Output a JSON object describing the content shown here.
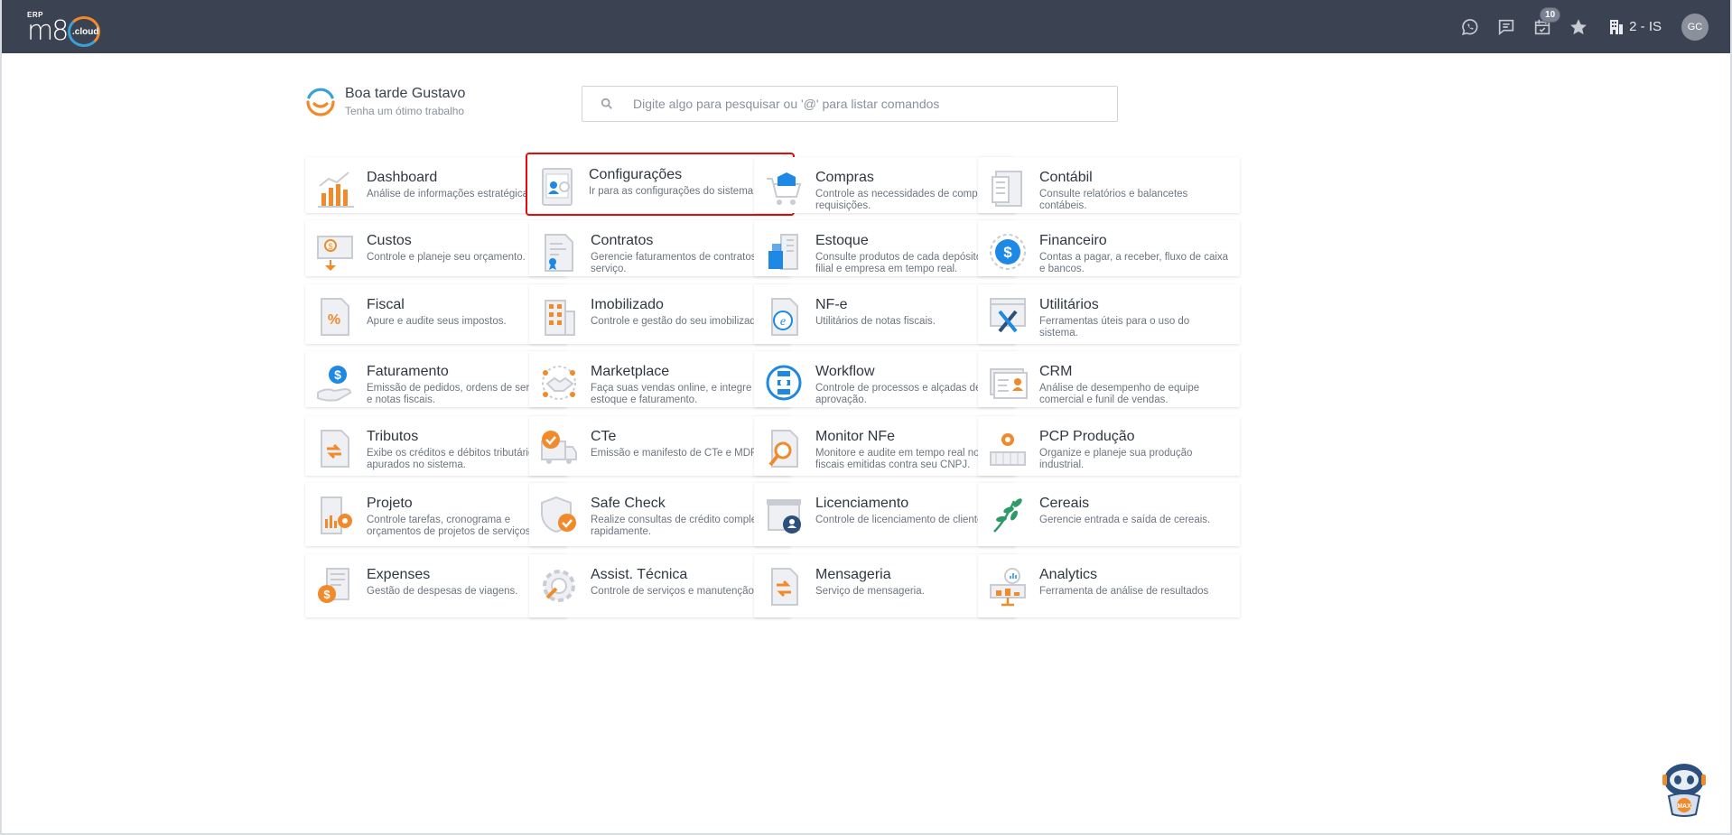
{
  "header": {
    "logo_erp": "ERP",
    "logo_m8": "m8",
    "logo_cloud": ".cloud",
    "notifications_count": "10",
    "company": "2 - IS",
    "avatar_initials": "GC"
  },
  "greeting": {
    "title": "Boa tarde Gustavo",
    "subtitle": "Tenha um ótimo trabalho"
  },
  "search": {
    "placeholder": "Digite algo para pesquisar ou '@' para listar comandos"
  },
  "modules": [
    {
      "title": "Dashboard",
      "desc": "Análise de informações estratégicas.",
      "icon": "dashboard-icon"
    },
    {
      "title": "Configurações",
      "desc": "Ir para as configurações do sistema.",
      "icon": "settings-icon",
      "active": true
    },
    {
      "title": "Compras",
      "desc": "Controle as necessidades de compras e requisições.",
      "icon": "cart-icon"
    },
    {
      "title": "Contábil",
      "desc": "Consulte relatórios e balancetes contábeis.",
      "icon": "accounting-icon"
    },
    {
      "title": "Custos",
      "desc": "Controle e planeje seu orçamento.",
      "icon": "costs-icon"
    },
    {
      "title": "Contratos",
      "desc": "Gerencie faturamentos de contratos de serviço.",
      "icon": "contract-icon"
    },
    {
      "title": "Estoque",
      "desc": "Consulte produtos de cada depósito, filial e empresa em tempo real.",
      "icon": "stock-icon"
    },
    {
      "title": "Financeiro",
      "desc": "Contas a pagar, a receber, fluxo de caixa e bancos.",
      "icon": "finance-icon"
    },
    {
      "title": "Fiscal",
      "desc": "Apure e audite seus impostos.",
      "icon": "fiscal-icon"
    },
    {
      "title": "Imobilizado",
      "desc": "Controle e gestão do seu imobilizado.",
      "icon": "building-icon"
    },
    {
      "title": "NF-e",
      "desc": "Utilitários de notas fiscais.",
      "icon": "nfe-icon"
    },
    {
      "title": "Utilitários",
      "desc": "Ferramentas úteis para o uso do sistema.",
      "icon": "tools-icon"
    },
    {
      "title": "Faturamento",
      "desc": "Emissão de pedidos, ordens de serviço e notas fiscais.",
      "icon": "billing-icon"
    },
    {
      "title": "Marketplace",
      "desc": "Faça suas vendas online, e integre ao estoque e faturamento.",
      "icon": "handshake-icon"
    },
    {
      "title": "Workflow",
      "desc": "Controle de processos e alçadas de aprovação.",
      "icon": "workflow-icon"
    },
    {
      "title": "CRM",
      "desc": "Análise de desempenho de equipe comercial e funil de vendas.",
      "icon": "crm-icon"
    },
    {
      "title": "Tributos",
      "desc": "Exibe os créditos e débitos tributários apurados no sistema.",
      "icon": "taxes-icon"
    },
    {
      "title": "CTe",
      "desc": "Emissão e manifesto de CTe e MDFe.",
      "icon": "truck-icon"
    },
    {
      "title": "Monitor NFe",
      "desc": "Monitore e audite em tempo real notas fiscais emitidas contra seu CNPJ.",
      "icon": "magnifier-icon"
    },
    {
      "title": "PCP Produção",
      "desc": "Organize e planeje sua produção industrial.",
      "icon": "production-icon"
    },
    {
      "title": "Projeto",
      "desc": "Controle tarefas, cronograma e orçamentos de projetos de serviços.",
      "icon": "project-icon"
    },
    {
      "title": "Safe Check",
      "desc": "Realize consultas de crédito completas rapidamente.",
      "icon": "shield-check-icon"
    },
    {
      "title": "Licenciamento",
      "desc": "Controle de licenciamento de clientes.",
      "icon": "license-icon"
    },
    {
      "title": "Cereais",
      "desc": "Gerencie entrada e saída de cereais.",
      "icon": "leaf-icon"
    },
    {
      "title": "Expenses",
      "desc": "Gestão de despesas de viagens.",
      "icon": "expenses-icon"
    },
    {
      "title": "Assist. Técnica",
      "desc": "Controle de serviços e manutenção",
      "icon": "gear-service-icon"
    },
    {
      "title": "Mensageria",
      "desc": "Serviço de mensageria.",
      "icon": "messaging-icon"
    },
    {
      "title": "Analytics",
      "desc": "Ferramenta de análise de resultados",
      "icon": "analytics-icon"
    }
  ],
  "assistant": {
    "label": "MAX"
  }
}
